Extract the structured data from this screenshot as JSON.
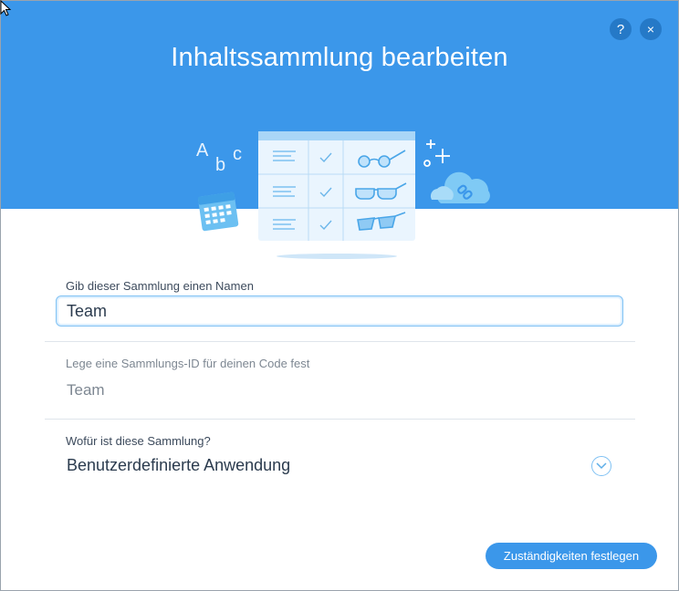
{
  "dialog": {
    "title": "Inhaltssammlung bearbeiten",
    "help_label": "?",
    "close_label": "×"
  },
  "illustration": {
    "letters": [
      "A",
      "b",
      "c"
    ]
  },
  "form": {
    "name_label": "Gib dieser Sammlung einen Namen",
    "name_value": "Team",
    "id_label": "Lege eine Sammlungs-ID für deinen Code fest",
    "id_value": "Team",
    "purpose_label": "Wofür ist diese Sammlung?",
    "purpose_value": "Benutzerdefinierte Anwendung"
  },
  "footer": {
    "primary_button": "Zuständigkeiten festlegen"
  },
  "colors": {
    "header": "#3b97ea",
    "icon_button": "#2579c7",
    "input_border": "#7fc1f3",
    "text": "#2b3b4e",
    "muted": "#7d8792"
  },
  "icons": [
    "help-icon",
    "close-icon",
    "chevron-down-icon",
    "calendar-icon",
    "cloud-link-icon",
    "glasses-icon",
    "checkmark-icon"
  ]
}
